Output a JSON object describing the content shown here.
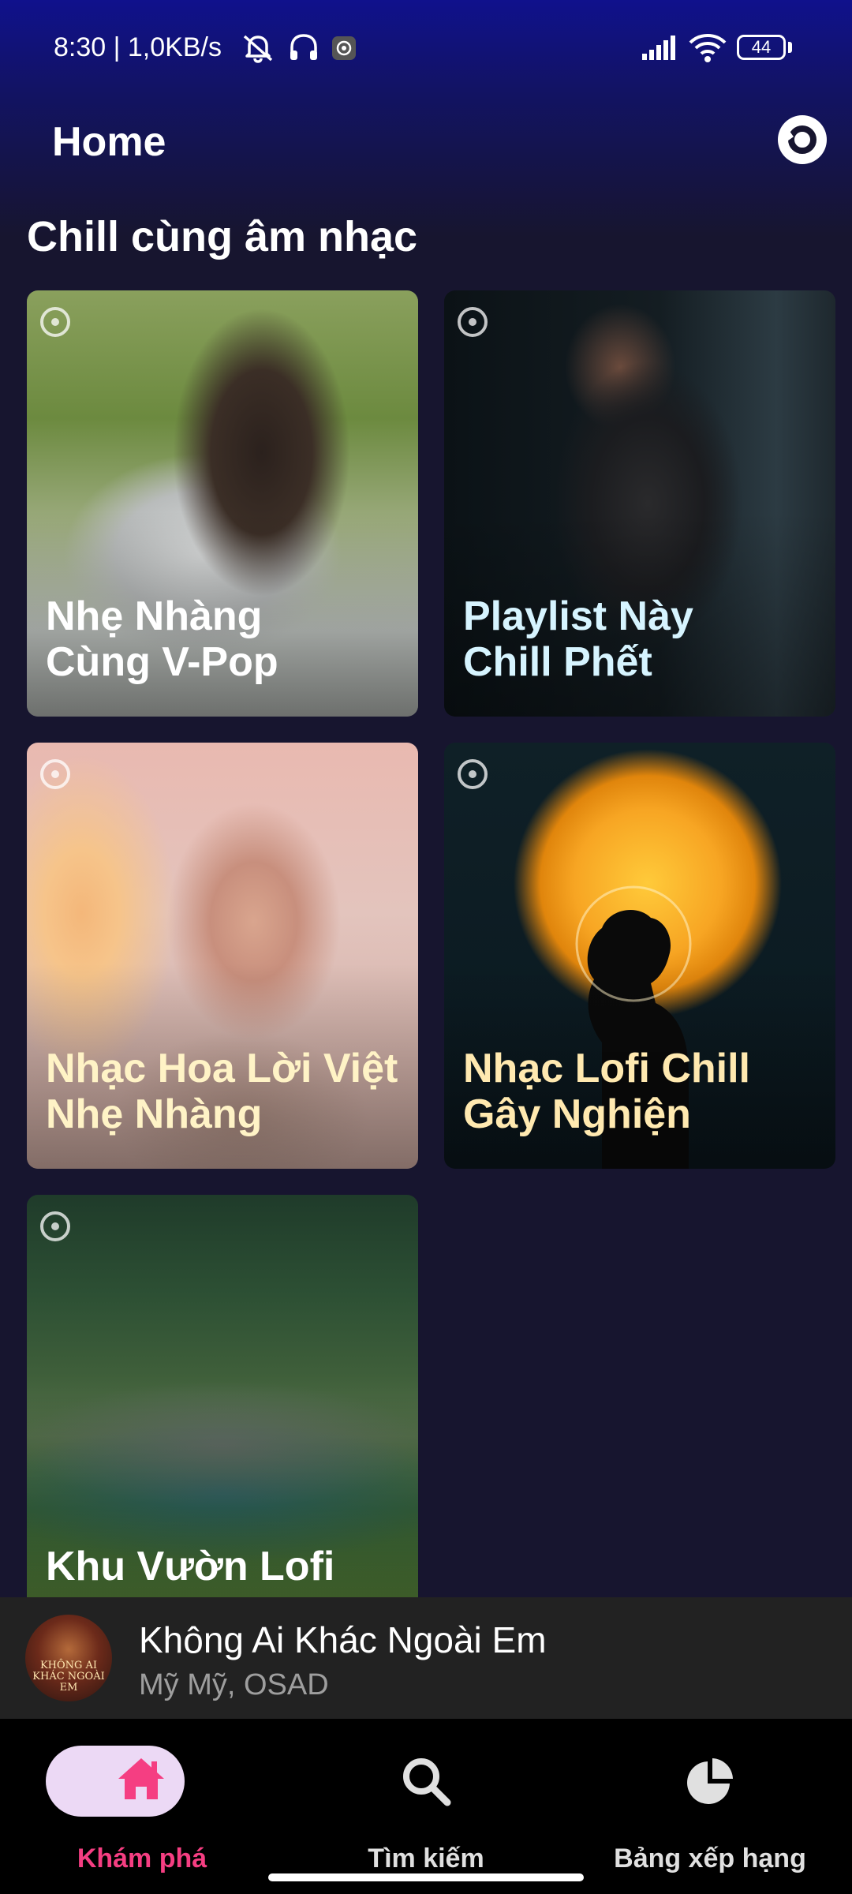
{
  "status_bar": {
    "time": "8:30 | 1,0KB/s",
    "battery": "44"
  },
  "header": {
    "title": "Home",
    "action_icon": "disc-icon"
  },
  "section": {
    "title": "Chill cùng âm nhạc"
  },
  "playlists": [
    {
      "title": "Nhẹ Nhàng\nCùng V-Pop",
      "title_color": "#ffffff"
    },
    {
      "title": "Playlist Này\nChill Phết",
      "title_color": "#d6f4ff"
    },
    {
      "title": "Nhạc Hoa Lời Việt\nNhẹ Nhàng",
      "title_color": "#fff3c6"
    },
    {
      "title": "Nhạc Lofi Chill\nGây Nghiện",
      "title_color": "#ffe9b0"
    },
    {
      "title": "Khu Vườn Lofi",
      "title_color": "#ffffff"
    }
  ],
  "mini_player": {
    "cover_text": "KHÔNG AI KHÁC NGOÀI EM",
    "title": "Không Ai Khác Ngoài Em",
    "artist": "Mỹ Mỹ, OSAD"
  },
  "bottom_nav": {
    "items": [
      {
        "label": "Khám phá",
        "icon": "home-icon",
        "active": true
      },
      {
        "label": "Tìm kiếm",
        "icon": "search-icon",
        "active": false
      },
      {
        "label": "Bảng xếp hạng",
        "icon": "pie-chart-icon",
        "active": false
      }
    ],
    "active_color": "#f53e82",
    "active_pill_color": "#ecd9f5"
  }
}
